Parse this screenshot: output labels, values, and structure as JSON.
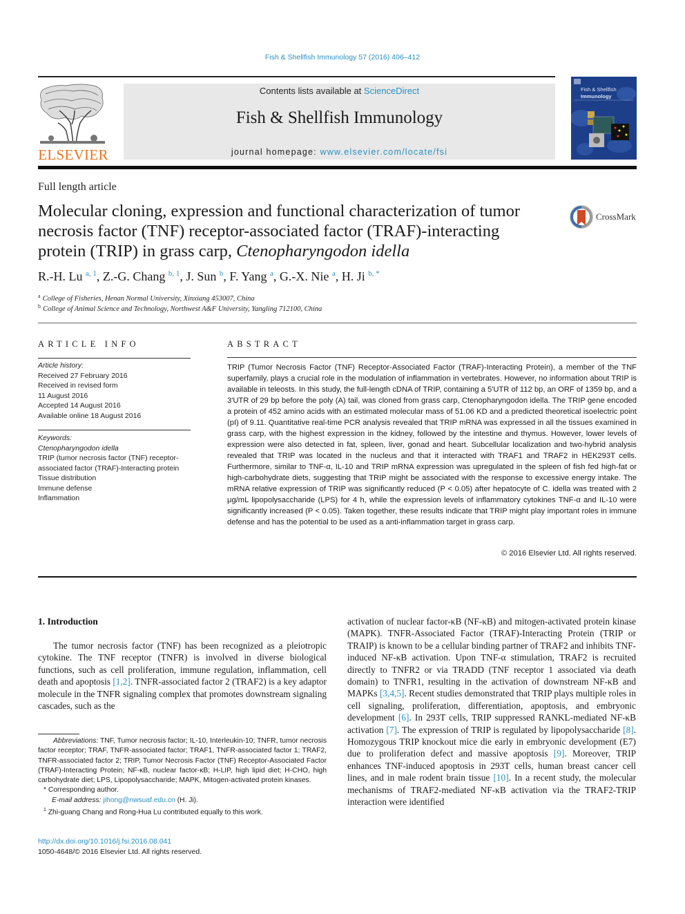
{
  "running_head": "Fish & Shellfish Immunology 57 (2016) 406–412",
  "masthead": {
    "publisher_logo_text": "ELSEVIER",
    "contents_prefix": "Contents lists available at ",
    "contents_link": "ScienceDirect",
    "journal_title": "Fish & Shellfish Immunology",
    "homepage_prefix": "journal homepage: ",
    "homepage_link": "www.elsevier.com/locate/fsi",
    "cover_title_line1": "Fish & Shellfish",
    "cover_title_line2": "Immunology",
    "brand_color": "#e9711c",
    "link_color": "#2a8fc0"
  },
  "article": {
    "type": "Full length article",
    "title_plain": "Molecular cloning, expression and functional characterization of tumor necrosis factor (TNF) receptor-associated factor (TRAF)-interacting protein (TRIP) in grass carp, ",
    "title_italic": "Ctenopharyngodon idella",
    "crossmark_label": "CrossMark",
    "authors": [
      {
        "name": "R.-H. Lu",
        "sup": "a, 1"
      },
      {
        "name": "Z.-G. Chang",
        "sup": "b, 1"
      },
      {
        "name": "J. Sun",
        "sup": "b"
      },
      {
        "name": "F. Yang",
        "sup": "a"
      },
      {
        "name": "G.-X. Nie",
        "sup": "a"
      },
      {
        "name": "H. Ji",
        "sup": "b, *"
      }
    ],
    "affiliations": [
      {
        "key": "a",
        "text": "College of Fisheries, Henan Normal University, Xinxiang 453007, China"
      },
      {
        "key": "b",
        "text": "College of Animal Science and Technology, Northwest A&F University, Yangling 712100, China"
      }
    ]
  },
  "article_info": {
    "heading": "ARTICLE INFO",
    "history_label": "Article history:",
    "history": [
      "Received 27 February 2016",
      "Received in revised form",
      "11 August 2016",
      "Accepted 14 August 2016",
      "Available online 18 August 2016"
    ],
    "keywords_label": "Keywords:",
    "keywords": [
      "Ctenopharyngodon idella",
      "TRIP (tumor necrosis factor (TNF) receptor-associated factor (TRAF)-Interacting protein",
      "Tissue distribution",
      "Immune defense",
      "Inflammation"
    ]
  },
  "abstract": {
    "heading": "ABSTRACT",
    "text": "TRIP (Tumor Necrosis Factor (TNF) Receptor-Associated Factor (TRAF)-Interacting Protein), a member of the TNF superfamily, plays a crucial role in the modulation of inflammation in vertebrates. However, no information about TRIP is available in teleosts. In this study, the full-length cDNA of TRIP, containing a 5′UTR of 112 bp, an ORF of 1359 bp, and a 3′UTR of 29 bp before the poly (A) tail, was cloned from grass carp, Ctenopharyngodon idella. The TRIP gene encoded a protein of 452 amino acids with an estimated molecular mass of 51.06 KD and a predicted theoretical isoelectric point (pI) of 9.11. Quantitative real-time PCR analysis revealed that TRIP mRNA was expressed in all the tissues examined in grass carp, with the highest expression in the kidney, followed by the intestine and thymus. However, lower levels of expression were also detected in fat, spleen, liver, gonad and heart. Subcellular localization and two-hybrid analysis revealed that TRIP was located in the nucleus and that it interacted with TRAF1 and TRAF2 in HEK293T cells. Furthermore, similar to TNF-α, IL-10 and TRIP mRNA expression was upregulated in the spleen of fish fed high-fat or high-carbohydrate diets, suggesting that TRIP might be associated with the response to excessive energy intake. The mRNA relative expression of TRIP was significantly reduced (P < 0.05) after hepatocyte of C. idella was treated with 2 μg/mL lipopolysaccharide (LPS) for 4 h, while the expression levels of inflammatory cytokines TNF-α and IL-10 were significantly increased (P < 0.05). Taken together, these results indicate that TRIP might play important roles in immune defense and has the potential to be used as a anti-inflammation target in grass carp.",
    "copyright": "© 2016 Elsevier Ltd. All rights reserved."
  },
  "introduction": {
    "heading": "1.  Introduction",
    "left_parts": [
      "The tumor necrosis factor (TNF) has been recognized as a pleiotropic cytokine. The TNF receptor (TNFR) is involved in diverse biological functions, such as cell proliferation, immune regulation, inflammation, cell death and apoptosis ",
      "[1,2]",
      ". TNFR-associated factor 2 (TRAF2) is a key adaptor molecule in the TNFR signaling complex that promotes downstream signaling cascades, such as the"
    ],
    "right_parts": [
      "activation of nuclear factor-κB (NF-κB) and mitogen-activated protein kinase (MAPK). TNFR-Associated Factor (TRAF)-Interacting Protein (TRIP or TRAIP) is known to be a cellular binding partner of TRAF2 and inhibits TNF-induced NF-κB activation. Upon TNF-α stimulation, TRAF2 is recruited directly to TNFR2 or via TRADD (TNF receptor 1 associated via death domain) to TNFR1, resulting in the activation of downstream NF-κB and MAPKs ",
      "[3,4,5]",
      ". Recent studies demonstrated that TRIP plays multiple roles in cell signaling, proliferation, differentiation, apoptosis, and embryonic development ",
      "[6]",
      ". In 293T cells, TRIP suppressed RANKL-mediated NF-κB activation ",
      "[7]",
      ". The expression of TRIP is regulated by lipopolysaccharide ",
      "[8]",
      ". Homozygous TRIP knockout mice die early in embryonic development (E7) due to proliferation defect and massive apoptosis ",
      "[9]",
      ". Moreover, TRIP enhances TNF-induced apoptosis in 293T cells, human breast cancer cell lines, and in male rodent brain tissue ",
      "[10]",
      ". In a recent study, the molecular mechanisms of TRAF2-mediated NF-κB activation via the TRAF2-TRIP interaction were identified"
    ]
  },
  "footnotes": {
    "abbrev_label": "Abbreviations:",
    "abbrev_text": " TNF, Tumor necrosis factor; IL-10, Interleukin-10; TNFR, tumor necrosis factor receptor; TRAF, TNFR-associated factor; TRAF1, TNFR-associated factor 1; TRAF2, TNFR-associated factor 2; TRIP, Tumor Necrosis Factor (TNF) Receptor-Associated Factor (TRAF)-Interacting Protein; NF-κB, nuclear factor-κB; H-LIP, high lipid diet; H-CHO, high carbohydrate diet; LPS, Lipopolysaccharide; MAPK, Mitogen-activated protein kinases.",
    "corresponding_mark": "*",
    "corresponding": " Corresponding author.",
    "email_label": "E-mail address:",
    "email": "jihong@nwsuaf.edu.cn",
    "email_suffix": " (H. Ji).",
    "equal_mark": "1",
    "equal_text": " Zhi-guang Chang and Rong-Hua Lu contributed equally to this work."
  },
  "bottom": {
    "doi": "http://dx.doi.org/10.1016/j.fsi.2016.08.041",
    "issn": "1050-4648/© 2016 Elsevier Ltd. All rights reserved."
  }
}
